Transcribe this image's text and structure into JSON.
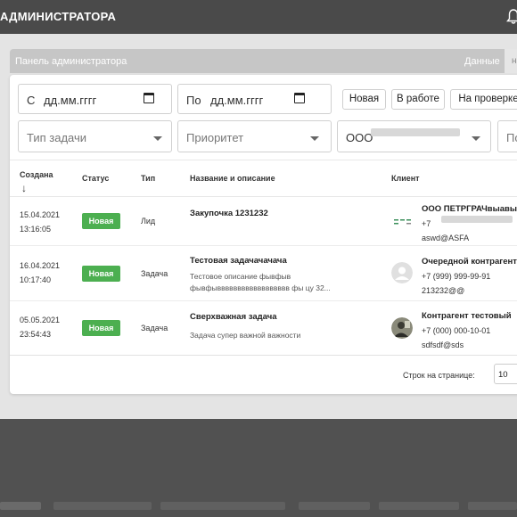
{
  "topbar": {
    "title": "АДМИНИСТРАТОРА",
    "bell_icon": "bell-icon"
  },
  "adminbar": {
    "label": "Панель администратора",
    "data_tab": "Данные",
    "tab2": "на р"
  },
  "filters": {
    "from_prefix": "С",
    "from_value": "дд.мм.гггг",
    "to_prefix": "По",
    "to_value": "дд.мм.гггг",
    "task_type_placeholder": "Тип задачи",
    "priority_placeholder": "Приоритет",
    "org_value": "ООО",
    "fourth_placeholder": "По",
    "status_chips": [
      "Новая",
      "В работе",
      "На проверке"
    ]
  },
  "table": {
    "headers": {
      "created": "Создана",
      "status": "Статус",
      "type": "Тип",
      "name": "Название и описание",
      "client": "Клиент"
    },
    "rows": [
      {
        "date": "15.04.2021",
        "time": "13:16:05",
        "status": "Новая",
        "type": "Лид",
        "title": "Закупочка 1231232",
        "desc1": "",
        "desc2": "",
        "client_name": "ООО ПЕТРГРАЧвыавыа",
        "client_phone": "+7",
        "client_email": "aswd@ASFA"
      },
      {
        "date": "16.04.2021",
        "time": "10:17:40",
        "status": "Новая",
        "type": "Задача",
        "title": "Тестовая задачачачача",
        "desc1": "Тестовое описание фывфыв",
        "desc2": "фывфывввввввввввввввввв фы цу 32...",
        "client_name": "Очередной контрагент",
        "client_phone": "+7 (999) 999-99-91",
        "client_email": "213232@@"
      },
      {
        "date": "05.05.2021",
        "time": "23:54:43",
        "status": "Новая",
        "type": "Задача",
        "title": "Сверхважная задача",
        "desc1": "Задача супер важной важности",
        "desc2": "",
        "client_name": "Контрагент тестовый",
        "client_phone": "+7 (000) 000-10-01",
        "client_email": "sdfsdf@sds"
      }
    ]
  },
  "pagination": {
    "rows_per_page_label": "Строк на странице:",
    "rows_per_page_value": "10"
  },
  "colors": {
    "badge_new": "#4caf50",
    "topbar": "#4a4a4a"
  }
}
